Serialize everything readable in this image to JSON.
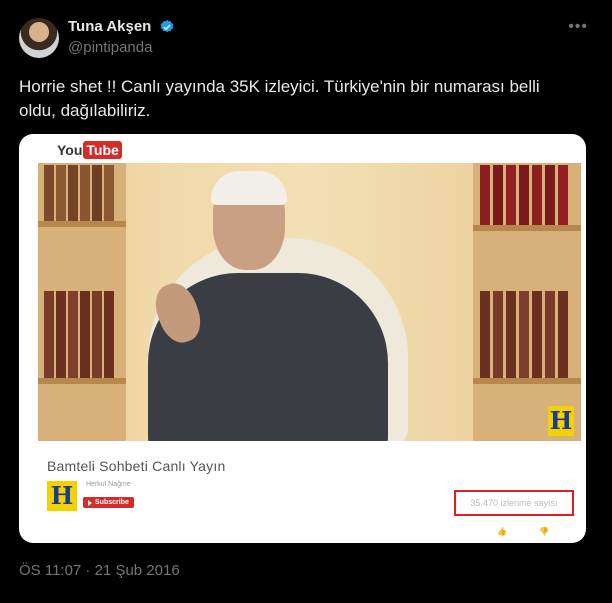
{
  "author": {
    "name": "Tuna Akşen",
    "handle": "@pintipanda"
  },
  "menu_icon": "more-icon",
  "tweet": {
    "text_line1": "Horrie shet !! Canlı yayında 35K izleyici. Türkiye'nin bir numarası belli",
    "text_line2": "oldu, dağılabiliriz."
  },
  "embedded_card": {
    "youtube_you": "You",
    "youtube_tube": "Tube",
    "video_title": "Bamteli Sohbeti Canlı Yayın",
    "channel_logo_letter": "H",
    "subscribe_label": "Subscribe",
    "watching_count": "35.470 izlenme sayısı",
    "channel_name": "Herkul Nağme"
  },
  "timestamp": "ÖS 11:07 · 21 Şub 2016",
  "colors": {
    "background": "#000000",
    "text": "#e7e9ea",
    "muted": "#71767b",
    "verified": "#1d9bf0",
    "youtube_red": "#d42b2b",
    "highlight": "#e02020"
  }
}
